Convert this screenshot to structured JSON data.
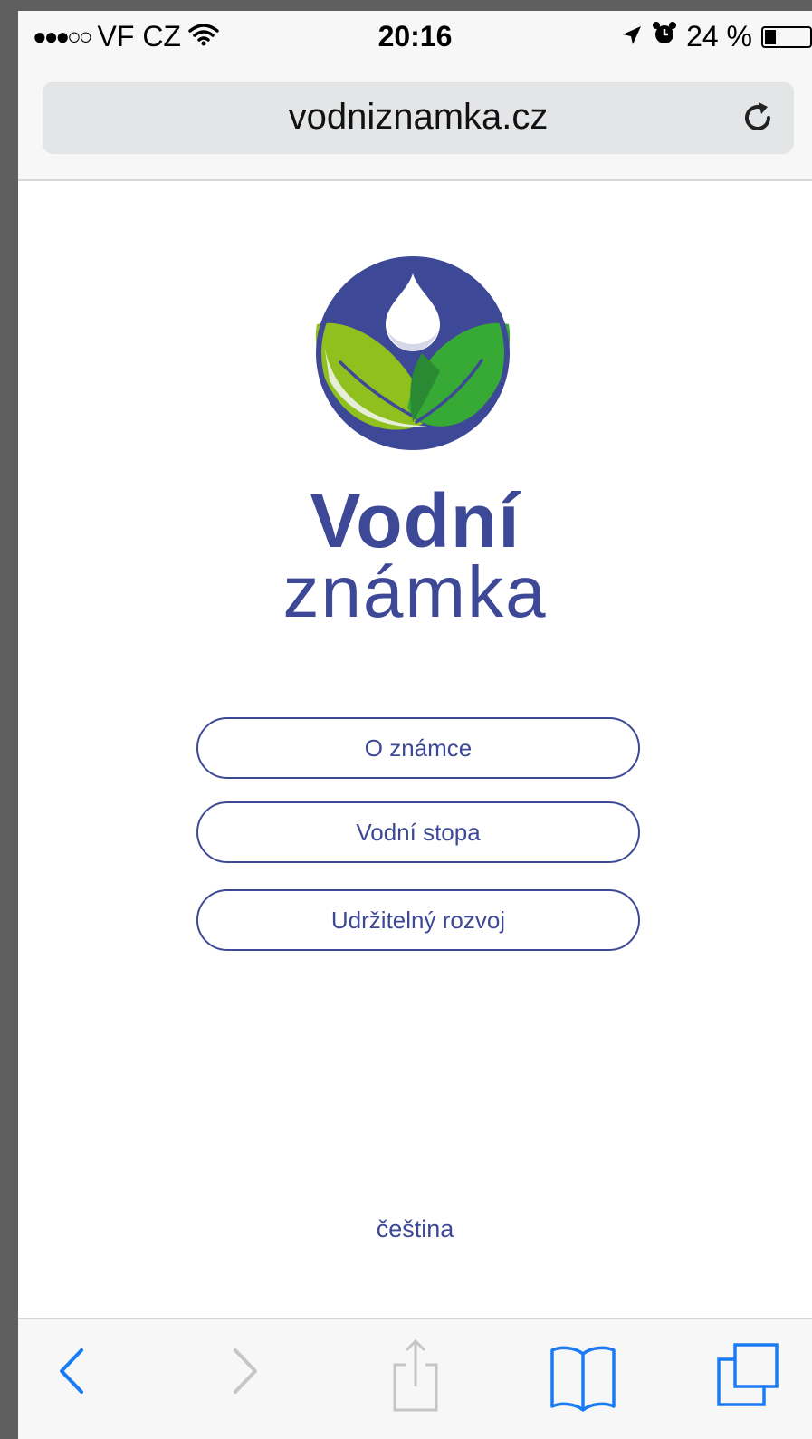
{
  "status_bar": {
    "signal": "●●●○○",
    "carrier": "VF CZ",
    "time": "20:16",
    "battery_text": "24 %",
    "battery_level": 0.24
  },
  "address_bar": {
    "url": "vodniznamka.cz",
    "reload_icon": "reload-icon"
  },
  "brand": {
    "line1": "Vodní",
    "line2": "známka",
    "colors": {
      "primary": "#3d4996",
      "leaf_light": "#8fc01e",
      "leaf_dark": "#37a935"
    }
  },
  "menu": {
    "items": [
      {
        "label": "O známce"
      },
      {
        "label": "Vodní stopa"
      },
      {
        "label": "Udržitelný rozvoj"
      }
    ]
  },
  "footer": {
    "language": "čeština"
  },
  "toolbar": {
    "icons": [
      "back-icon",
      "forward-icon",
      "share-icon",
      "bookmarks-icon",
      "tabs-icon"
    ],
    "accent": "#1a7cf5"
  }
}
